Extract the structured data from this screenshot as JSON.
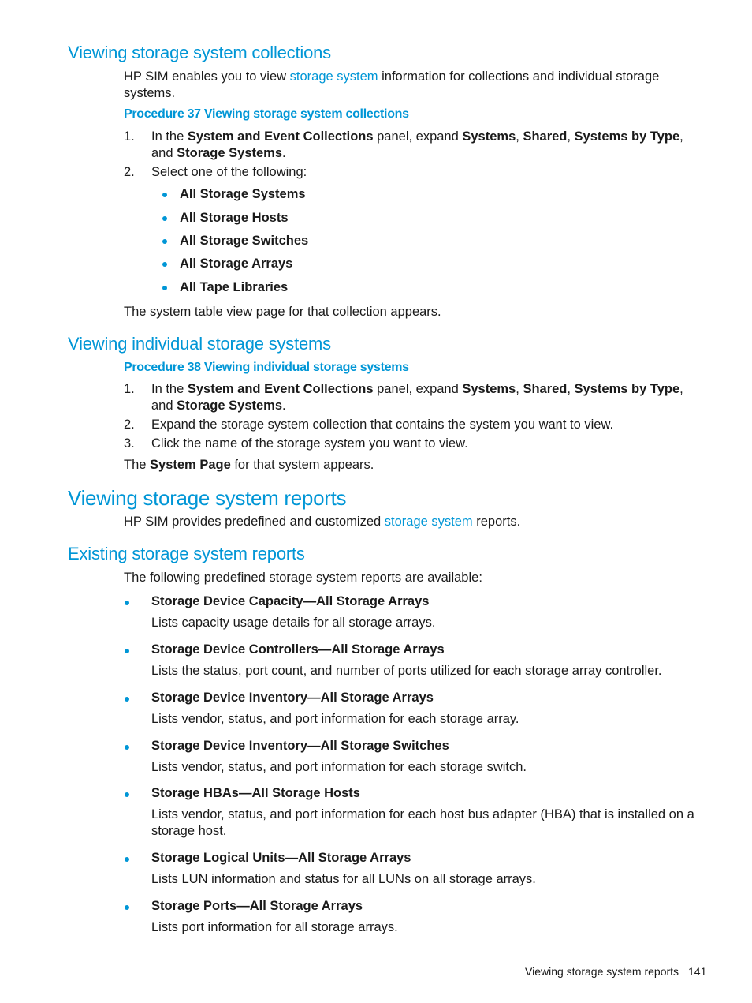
{
  "accent_color": "#0096d6",
  "section1": {
    "heading": "Viewing storage system collections",
    "intro_pre": "HP SIM enables you to view ",
    "intro_link": "storage system",
    "intro_post": " information for collections and individual storage systems.",
    "procedure_title": "Procedure 37 Viewing storage system collections",
    "steps": [
      {
        "num": "1.",
        "parts": [
          "In the ",
          "System and Event Collections",
          " panel, expand ",
          "Systems",
          ", ",
          "Shared",
          ", ",
          "Systems by Type",
          ", and ",
          "Storage Systems",
          "."
        ]
      },
      {
        "num": "2.",
        "text": "Select one of the following:"
      }
    ],
    "options": [
      "All Storage Systems",
      "All Storage Hosts",
      "All Storage Switches",
      "All Storage Arrays",
      "All Tape Libraries"
    ],
    "result": "The system table view page for that collection appears."
  },
  "section2": {
    "heading": "Viewing individual storage systems",
    "procedure_title": "Procedure 38 Viewing individual storage systems",
    "steps": [
      {
        "num": "1.",
        "parts": [
          "In the ",
          "System and Event Collections",
          " panel, expand ",
          "Systems",
          ", ",
          "Shared",
          ", ",
          "Systems by Type",
          ", and ",
          "Storage Systems",
          "."
        ]
      },
      {
        "num": "2.",
        "text": "Expand the storage system collection that contains the system you want to view."
      },
      {
        "num": "3.",
        "text": "Click the name of the storage system you want to view."
      }
    ],
    "result_pre": "The ",
    "result_bold": "System Page",
    "result_post": " for that system appears."
  },
  "section3": {
    "heading": "Viewing storage system reports",
    "intro_pre": "HP SIM provides predefined and customized ",
    "intro_link": "storage system",
    "intro_post": " reports."
  },
  "section4": {
    "heading": "Existing storage system reports",
    "intro": "The following predefined storage system reports are available:",
    "reports": [
      {
        "title": "Storage Device Capacity—All Storage Arrays",
        "desc": "Lists capacity usage details for all storage arrays."
      },
      {
        "title": "Storage Device Controllers—All Storage Arrays",
        "desc": "Lists the status, port count, and number of ports utilized for each storage array controller."
      },
      {
        "title": "Storage Device Inventory—All Storage Arrays",
        "desc": "Lists vendor, status, and port information for each storage array."
      },
      {
        "title": "Storage Device Inventory—All Storage Switches",
        "desc": "Lists vendor, status, and port information for each storage switch."
      },
      {
        "title": "Storage HBAs—All Storage Hosts",
        "desc": "Lists vendor, status, and port information for each host bus adapter (HBA) that is installed on a storage host."
      },
      {
        "title": "Storage Logical Units—All Storage Arrays",
        "desc": "Lists LUN information and status for all LUNs on all storage arrays."
      },
      {
        "title": "Storage Ports—All Storage Arrays",
        "desc": "Lists port information for all storage arrays."
      }
    ]
  },
  "footer": {
    "section_title": "Viewing storage system reports",
    "page_number": "141"
  }
}
